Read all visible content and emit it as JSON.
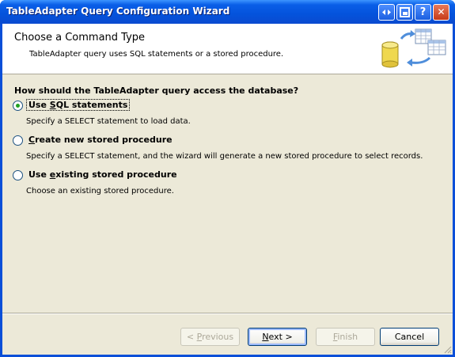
{
  "window": {
    "title": "TableAdapter Query Configuration Wizard",
    "controls": [
      "arrows-icon",
      "restore-icon",
      "help-icon",
      "close-icon"
    ],
    "help_label": "?",
    "close_label": "✕"
  },
  "header": {
    "title": "Choose a Command Type",
    "subtitle": "TableAdapter query uses SQL statements or a stored procedure."
  },
  "question": "How should the TableAdapter query access the database?",
  "options": [
    {
      "pre": "Use ",
      "key": "S",
      "post": "QL statements",
      "description": "Specify a SELECT statement to load data.",
      "selected": true
    },
    {
      "pre": "",
      "key": "C",
      "post": "reate new stored procedure",
      "description": "Specify a SELECT statement, and the wizard will generate a new stored procedure to select records.",
      "selected": false
    },
    {
      "pre": "Use ",
      "key": "e",
      "post": "xisting stored procedure",
      "description": "Choose an existing stored procedure.",
      "selected": false
    }
  ],
  "buttons": {
    "previous": {
      "pre": "< ",
      "key": "P",
      "post": "revious",
      "enabled": false
    },
    "next": {
      "pre": "",
      "key": "N",
      "post": "ext >",
      "enabled": true
    },
    "finish": {
      "pre": "",
      "key": "F",
      "post": "inish",
      "enabled": false
    },
    "cancel": {
      "label": "Cancel",
      "enabled": true
    }
  },
  "colors": {
    "titlebar": "#0a5fe8",
    "dialog_bg": "#ece9d8",
    "header_bg": "#ffffff",
    "radio_dot": "#21a121"
  }
}
